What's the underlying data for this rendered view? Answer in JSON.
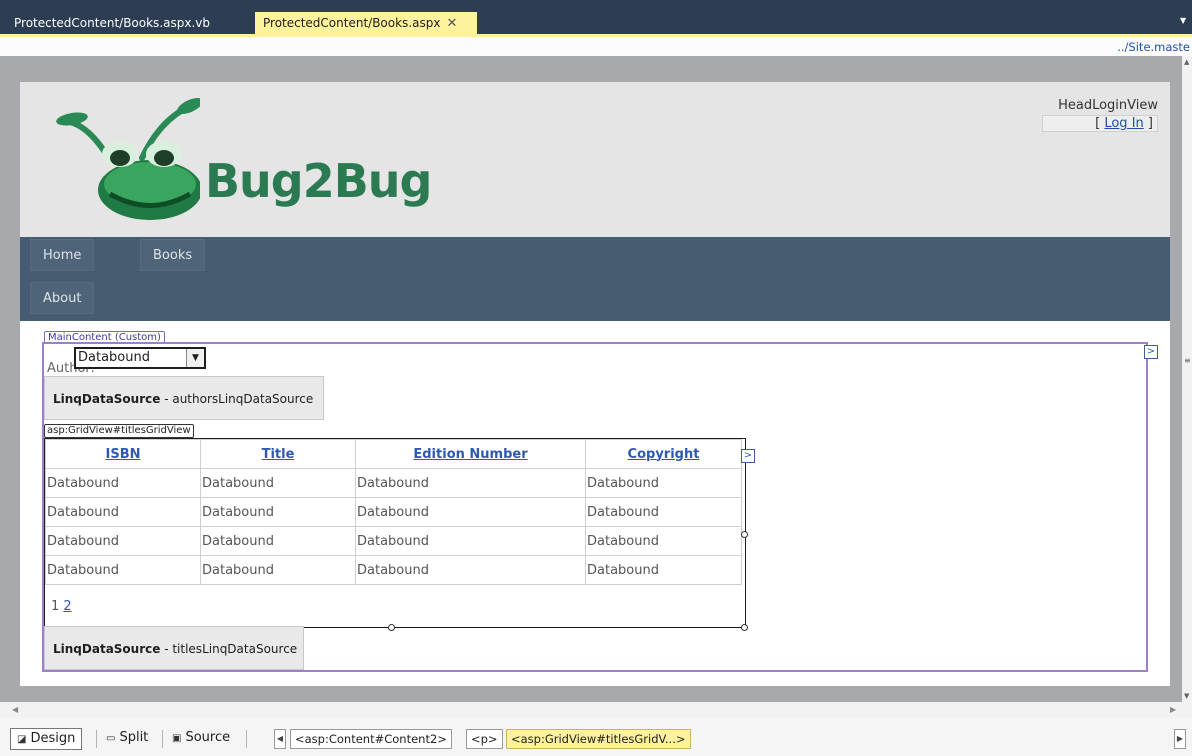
{
  "tabs": [
    {
      "label": "ProtectedContent/Books.aspx.vb",
      "active": false
    },
    {
      "label": "ProtectedContent/Books.aspx",
      "active": true
    }
  ],
  "master_path": "../Site.maste",
  "site": {
    "logo_text": "Bug2Bug",
    "head_login_view": "HeadLoginView",
    "login_prefix": "[ ",
    "login_link": "Log In",
    "login_suffix": " ]",
    "nav": [
      "Home",
      "Books",
      "About"
    ]
  },
  "main_content": {
    "region_tag": "MainContent (Custom)",
    "author_label": "Author:",
    "author_select_value": "Databound",
    "authors_source_type": "LinqDataSource",
    "authors_source_name": " - authorsLinqDataSource",
    "grid_tag": "asp:GridView#titlesGridView",
    "columns": [
      "ISBN",
      "Title",
      "Edition Number",
      "Copyright"
    ],
    "rows": [
      [
        "Databound",
        "Databound",
        "Databound",
        "Databound"
      ],
      [
        "Databound",
        "Databound",
        "Databound",
        "Databound"
      ],
      [
        "Databound",
        "Databound",
        "Databound",
        "Databound"
      ],
      [
        "Databound",
        "Databound",
        "Databound",
        "Databound"
      ]
    ],
    "pager": {
      "current": "1",
      "next": "2"
    },
    "titles_source_type": "LinqDataSource",
    "titles_source_name": " - titlesLinqDataSource"
  },
  "view_buttons": {
    "design": "Design",
    "split": "Split",
    "source": "Source"
  },
  "breadcrumbs": [
    "<asp:Content#Content2>",
    "<p>",
    "<asp:GridView#titlesGridV...>"
  ],
  "colors": {
    "tab_bar": "#2d3e54",
    "active_tab": "#fff29d",
    "nav_bar": "#465c71",
    "logo_green": "#2b7a52",
    "region_border": "#9b82c8",
    "link_blue": "#2f59b0"
  }
}
